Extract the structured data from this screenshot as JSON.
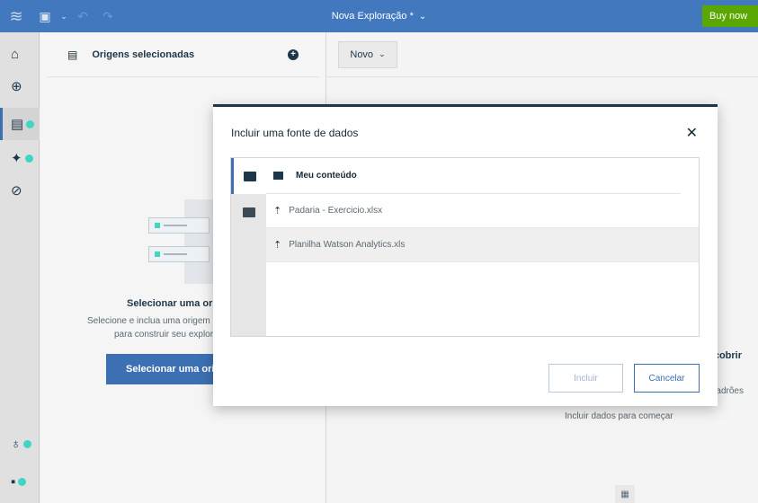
{
  "topbar": {
    "title": "Nova Exploração *",
    "buy_label": "Buy now"
  },
  "sources": {
    "header": "Origens selecionadas",
    "empty_title": "Selecionar uma origem",
    "empty_desc_line1": "Selecione e inclua uma origem",
    "empty_desc_line2": "para construir seu exploração",
    "select_button": "Selecionar uma origem"
  },
  "main": {
    "novo_label": "Novo",
    "frag_title": "Descobrir",
    "frag_desc": "padrões",
    "hint": "Incluir dados para começar"
  },
  "dialog": {
    "title": "Incluir uma fonte de dados",
    "crumb": "Meu conteúdo",
    "files": [
      "Padaria - Exercicio.xlsx",
      "Planilha Watson Analytics.xls"
    ],
    "incluir_label": "Incluir",
    "cancelar_label": "Cancelar"
  },
  "colors": {
    "topbar": "#4178be",
    "accent": "#3d70b2",
    "teal": "#41d6c3",
    "buy": "#5aa700"
  }
}
